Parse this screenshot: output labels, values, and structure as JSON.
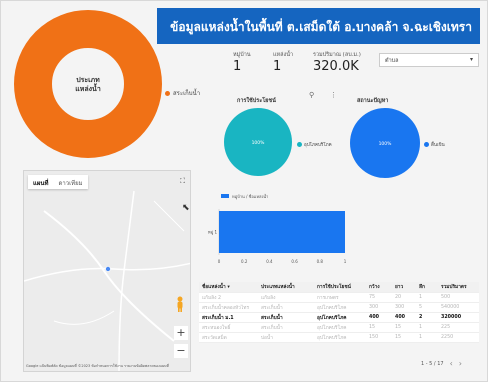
{
  "header": {
    "title": "ข้อมูลแหล่งน้ำในพื้นที่ ต.เสม็ดใต้ อ.บางคล้า จ.ฉะเชิงเทรา",
    "color": "#1565c0"
  },
  "big_donut": {
    "center_label_1": "ประเภท",
    "center_label_2": "แหล่งน้ำ",
    "legend": "สระเก็บน้ำ",
    "color": "#f07116"
  },
  "scorecards": [
    {
      "label": "หมู่บ้าน",
      "value": "1"
    },
    {
      "label": "แหล่งน้ำ",
      "value": "1"
    },
    {
      "label": "รวมปริมาณ (ลบ.ม.)",
      "value": "320.0K"
    }
  ],
  "filter": {
    "label": "ตำบล"
  },
  "pie_usage": {
    "title": "การใช้ประโยชน์",
    "legend": "อุปโภคบริโภค",
    "center": "100%",
    "color": "#19b5c2"
  },
  "pie_status": {
    "title": "สถานะปัญหา",
    "legend": "ตื้นเขิน",
    "center": "100%",
    "color": "#1976f0"
  },
  "toolbar": {
    "filter_icon": "filter-icon",
    "more_icon": "more-vert-icon"
  },
  "chart_data": {
    "type": "bar",
    "orientation": "horizontal",
    "legend": "หมู่บ้าน / ชื่อแหล่งน้ำ",
    "categories": [
      "หมู่ 1"
    ],
    "values": [
      1
    ],
    "xlim": [
      0,
      1
    ],
    "ticks": [
      "0",
      "0.2",
      "0.4",
      "0.6",
      "0.8",
      "1"
    ],
    "color": "#1976f0"
  },
  "map": {
    "tab_map": "แผนที่",
    "tab_satellite": "ดาวเทียม",
    "zoom_in": "+",
    "zoom_out": "−",
    "footer": "Google   แป้นพิมพ์ลัด   ข้อมูลแผนที่ ©2023   ข้อกำหนดการใช้งาน   รายงานข้อผิดพลาดของแผนที่"
  },
  "table": {
    "headers": [
      "ชื่อแหล่งน้ำ ▾",
      "ประเภทแหล่งน้ำ",
      "การใช้ประโยชน์",
      "กว้าง",
      "ยาว",
      "ลึก",
      "รวมปริมาตร"
    ],
    "rows": [
      {
        "cells": [
          "แก้มลิง 2",
          "แก้มลิง",
          "การเกษตร",
          "75",
          "20",
          "1",
          "500"
        ],
        "style": "dim"
      },
      {
        "cells": [
          "สระเก็บน้ำคลองหัวไทร",
          "สระเก็บน้ำ",
          "อุปโภคบริโภค",
          "300",
          "300",
          "5",
          "540000"
        ],
        "style": "dim"
      },
      {
        "cells": [
          "สระเก็บน้ำ ม.1",
          "สระเก็บน้ำ",
          "อุปโภคบริโภค",
          "400",
          "400",
          "2",
          "320000"
        ],
        "style": "bold"
      },
      {
        "cells": [
          "สระหนองโพธิ์",
          "สระเก็บน้ำ",
          "อุปโภคบริโภค",
          "15",
          "15",
          "1",
          "225"
        ],
        "style": "dim"
      },
      {
        "cells": [
          "สระวัดเสม็ด",
          "บ่อน้ำ",
          "อุปโภคบริโภค",
          "150",
          "15",
          "1",
          "2250"
        ],
        "style": "dim"
      }
    ]
  },
  "pager": {
    "label": "1 - 5 / 17",
    "prev": "‹",
    "next": "›"
  }
}
